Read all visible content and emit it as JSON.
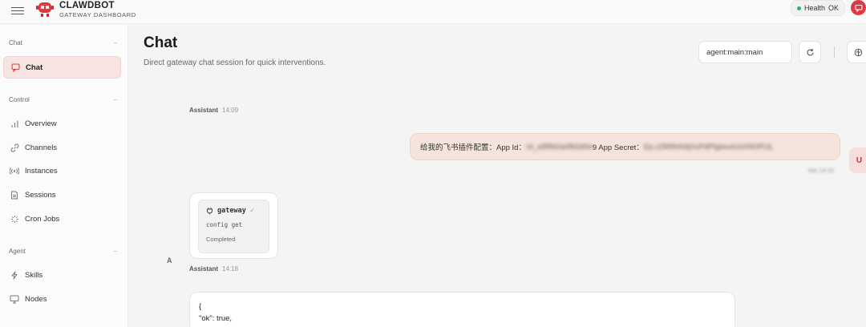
{
  "app": {
    "name": "CLAWDBOT",
    "subtitle": "GATEWAY DASHBOARD",
    "health_label": "Health",
    "health_value": "OK",
    "brand_color": "#e2383f"
  },
  "sidebar": {
    "sections": [
      {
        "title": "Chat",
        "collapse": "−",
        "items": [
          {
            "label": "Chat",
            "icon": "message-icon",
            "active": true
          }
        ]
      },
      {
        "title": "Control",
        "collapse": "−",
        "items": [
          {
            "label": "Overview",
            "icon": "bar-chart-icon"
          },
          {
            "label": "Channels",
            "icon": "link-icon"
          },
          {
            "label": "Instances",
            "icon": "broadcast-icon"
          },
          {
            "label": "Sessions",
            "icon": "document-icon"
          },
          {
            "label": "Cron Jobs",
            "icon": "loader-icon"
          }
        ]
      },
      {
        "title": "Agent",
        "collapse": "−",
        "items": [
          {
            "label": "Skills",
            "icon": "lightning-icon"
          },
          {
            "label": "Nodes",
            "icon": "monitor-icon"
          }
        ]
      }
    ]
  },
  "main": {
    "title": "Chat",
    "subtitle": "Direct gateway chat session for quick interventions.",
    "session_key": "agent:main:main"
  },
  "messages": {
    "first_assistant": {
      "sender": "Assistant",
      "time": "14:09"
    },
    "user": {
      "text_prefix": "给我的飞书插件配置：App Id：",
      "app_id_redacted": "cli_a9f9b0a0fb0d0e",
      "app_id_suffix": "9 App Secret：",
      "secret_redacted": "Ep.zZM9hN4jXxPdPtgbexiUoX9OPiJL",
      "time": "Yes 14:15",
      "avatar": "U"
    },
    "tool": {
      "name": "gateway",
      "command": "config get",
      "status": "Completed",
      "avatar": "A"
    },
    "second_assistant": {
      "sender": "Assistant",
      "time": "14:18"
    },
    "json_lines": [
      "{",
      "\"ok\": true,"
    ]
  }
}
